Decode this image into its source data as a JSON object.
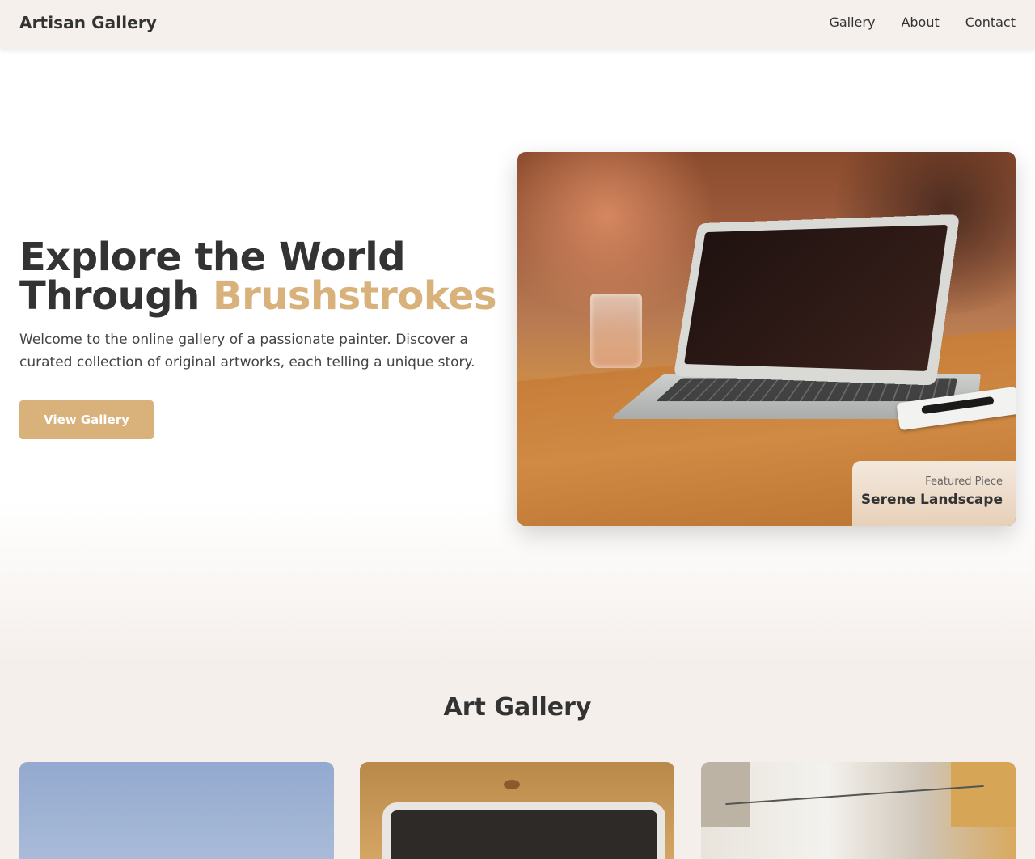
{
  "header": {
    "brand": "Artisan Gallery",
    "nav": [
      "Gallery",
      "About",
      "Contact"
    ]
  },
  "hero": {
    "title_line1": "Explore the World",
    "title_line2_plain": "Through",
    "title_line2_accent": "Brushstrokes",
    "description": "Welcome to the online gallery of a passionate painter. Discover a curated collection of original artworks, each telling a unique story.",
    "cta_label": "View Gallery",
    "featured_label": "Featured Piece",
    "featured_title": "Serene Landscape"
  },
  "gallery": {
    "title": "Art Gallery"
  },
  "colors": {
    "accent": "#d8b27a",
    "text": "#333333",
    "header_bg": "#f5f0ec",
    "section_bg": "#f5efeb"
  }
}
